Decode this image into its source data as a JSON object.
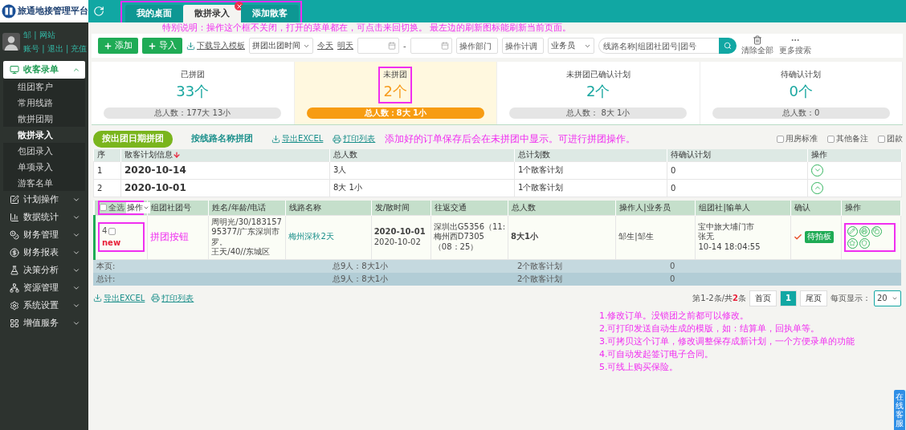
{
  "header": {
    "logo": "旅通地接管理平台",
    "tab_bar": {
      "highlighted": true,
      "tabs": [
        {
          "label": "我的桌面",
          "selected": false,
          "closable": false
        },
        {
          "label": "散拼录入",
          "selected": true,
          "closable": true
        },
        {
          "label": "添加散客",
          "selected": false,
          "closable": false
        }
      ]
    }
  },
  "user": {
    "lines": [
      "邹 | 网站",
      "账号 | 退出 | 充值"
    ]
  },
  "sidebar": {
    "sections": [
      {
        "label": "收客录单",
        "expanded": true,
        "children": [
          {
            "label": "组团客户",
            "selected": false
          },
          {
            "label": "常用线路",
            "selected": false
          },
          {
            "label": "散拼团期",
            "selected": false
          },
          {
            "label": "散拼录入",
            "selected": true
          },
          {
            "label": "包团录入",
            "selected": false
          },
          {
            "label": "单项录入",
            "selected": false
          },
          {
            "label": "游客名单",
            "selected": false
          }
        ]
      },
      {
        "label": "计划操作",
        "expanded": false
      },
      {
        "label": "数据统计",
        "expanded": false
      },
      {
        "label": "财务管理",
        "expanded": false
      },
      {
        "label": "财务报表",
        "expanded": false
      },
      {
        "label": "决策分析",
        "expanded": false
      },
      {
        "label": "资源管理",
        "expanded": false
      },
      {
        "label": "系统设置",
        "expanded": false
      },
      {
        "label": "增值服务",
        "expanded": false
      }
    ]
  },
  "notes": {
    "top": "特别说明：操作这个框不关闭，打开的菜单都在，可点击来回切换。 最左边的刷新图标能刷新当前页面。",
    "middle": "添加好的订单保存后会在未拼团中显示。可进行拼团操作。",
    "list": [
      "1.修改订单。没锁团之前都可以修改。",
      "2.可打印发送自动生成的模版，如：结算单，回执单等。",
      "3.可拷贝这个订单，修改调整保存成新计划，一个方便录单的功能",
      "4.可自动发起签订电子合同。",
      "5.可线上购买保险。"
    ]
  },
  "toolbar": {
    "buttons": [
      "添加",
      "导入"
    ],
    "template_link": "下载导入模板",
    "date_select": "拼团出团时间",
    "quick_dates": [
      "今天",
      "明天"
    ],
    "date_separator": "-",
    "fields": [
      {
        "placeholder": "操作部门"
      },
      {
        "placeholder": "操作计调"
      }
    ],
    "staff_select": "业务员",
    "search": {
      "placeholder": "线路名称|组团社团号|团号"
    },
    "actions": [
      "清除全部",
      "更多搜索"
    ]
  },
  "stats": [
    {
      "title": "已拼团",
      "count": "33个",
      "total": "总人数：177大 13小",
      "selected": false,
      "highlighted": false
    },
    {
      "title": "未拼团",
      "count": "2个",
      "total": "总人数：8大 1小",
      "selected": true,
      "highlighted": true
    },
    {
      "title": "未拼团已确认计划",
      "count": "2个",
      "total": "总人数： 8大 1小",
      "selected": false,
      "highlighted": false
    },
    {
      "title": "待确认计划",
      "count": "0个",
      "total": "总人数：0",
      "selected": false,
      "highlighted": false
    }
  ],
  "group_tabs": [
    {
      "label": "按出团日期拼团",
      "selected": true
    },
    {
      "label": "按线路名称拼团",
      "selected": false
    }
  ],
  "exports": [
    "导出EXCEL",
    "打印列表"
  ],
  "column_options": [
    {
      "label": "用房标准",
      "checked": false
    },
    {
      "label": "其他备注",
      "checked": false
    },
    {
      "label": "团款",
      "checked": false
    }
  ],
  "group_table": {
    "columns": [
      "序",
      "散客计划信息",
      "总人数",
      "总计划数",
      "待确认计划",
      "操作"
    ],
    "rows": [
      {
        "index": "1",
        "date": "2020-10-14",
        "total": "3人",
        "plans": "1个散客计划",
        "pending": "0",
        "expanded": false
      },
      {
        "index": "2",
        "date": "2020-10-01",
        "total": "8大 1小",
        "plans": "1个散客计划",
        "pending": "0",
        "expanded": true
      }
    ]
  },
  "detail_table": {
    "select_all": "全选",
    "select_all_checked": false,
    "bulk_action": "操作",
    "select_highlighted": true,
    "columns": [
      "组团社团号",
      "姓名/年龄/电话",
      "线路名称",
      "发/散时间",
      "往返交通",
      "总人数",
      "操作人|业务员",
      "组团社|输单人",
      "确认",
      "操作"
    ],
    "rows": [
      {
        "index": "4",
        "checked": false,
        "tag": "new",
        "annotation": "拼团按钮",
        "guests": [
          "周明光/30/18315795377/广东深圳市罗。",
          "王天/40//东城区"
        ],
        "route": "梅州深秋2天",
        "dates": [
          "2020-10-01",
          "2020-10-02"
        ],
        "transport": [
          "深圳出G5356（11:",
          "梅州西D7305",
          "（08：25）"
        ],
        "total": "8大1小",
        "staff": "邹生|邹生",
        "agency": [
          "宝中旅大埔门市",
          "张无",
          "10-14 18:04:55"
        ],
        "confirmed": true,
        "status": "待拍板",
        "actions_highlighted": true
      }
    ],
    "summary": [
      {
        "label": "本页:",
        "total": "总9人：8大1小",
        "plans": "2个散客计划",
        "pending": "0"
      },
      {
        "label": "总计:",
        "total": "总9人：8大1小",
        "plans": "2个散客计划",
        "pending": "0"
      }
    ]
  },
  "bottom_exports": [
    "导出EXCEL",
    "打印列表"
  ],
  "pagination": {
    "info_prefix": "第1-2条/共",
    "info_count": "2",
    "info_suffix": "条",
    "pages": [
      {
        "label": "首页",
        "selected": false
      },
      {
        "label": "1",
        "selected": true
      },
      {
        "label": "尾页",
        "selected": false
      }
    ],
    "per_page_label": "每页显示：",
    "per_page": "20"
  },
  "service": "在线客服"
}
